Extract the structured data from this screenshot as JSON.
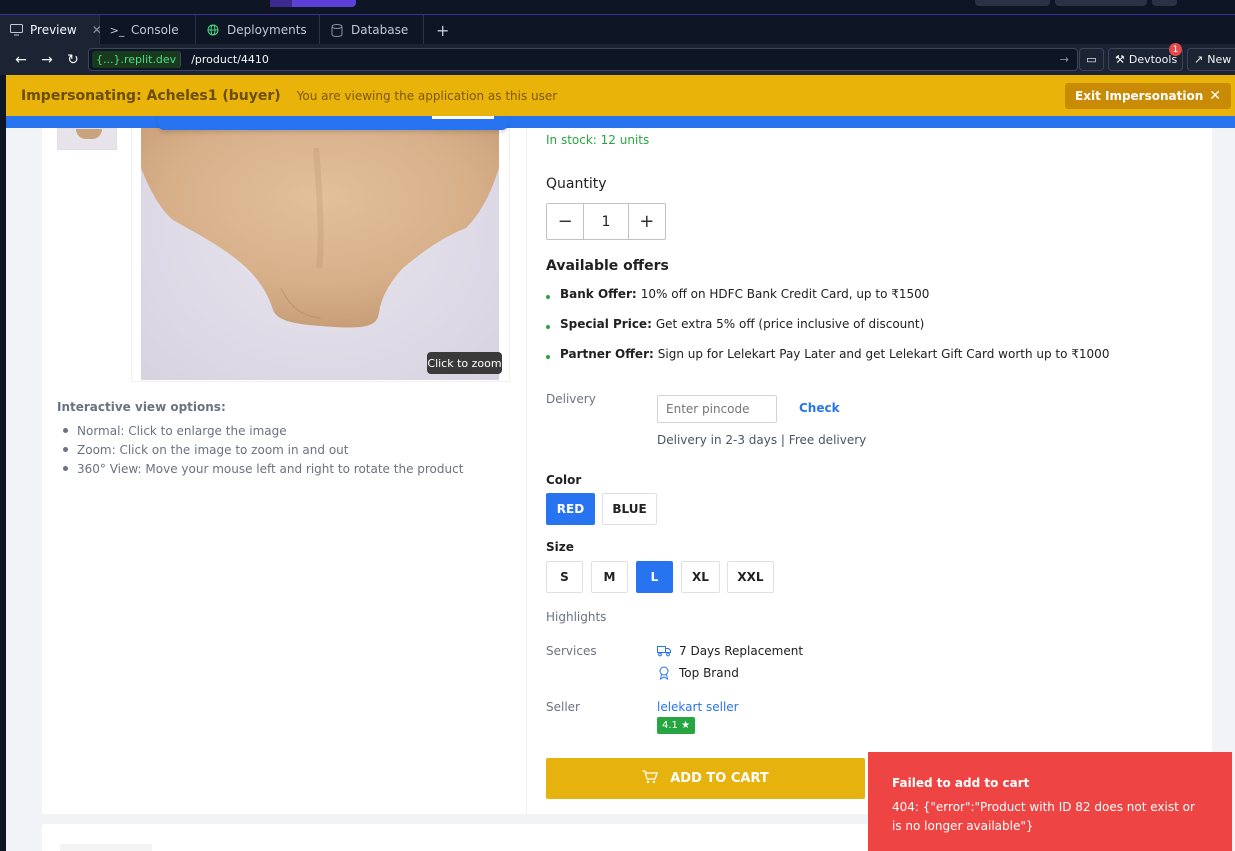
{
  "ide": {
    "tabs": [
      {
        "label": "Preview",
        "icon": "monitor-icon",
        "active": true,
        "closable": true
      },
      {
        "label": "Console",
        "icon": "terminal-icon"
      },
      {
        "label": "Deployments",
        "icon": "globe-icon"
      },
      {
        "label": "Database",
        "icon": "database-icon"
      }
    ],
    "add_tab": "+"
  },
  "urlbar": {
    "domain": "{...}.replit.dev",
    "path": "/product/4410",
    "devtools_label": "Devtools",
    "devtools_badge": "1",
    "new_tab_label": "New"
  },
  "banner": {
    "title": "Impersonating: Acheles1 (buyer)",
    "subtitle": "You are viewing the application as this user",
    "exit_label": "Exit Impersonation",
    "color": "#e9b309"
  },
  "product": {
    "zoom_tooltip": "Click to zoom",
    "interactive_title": "Interactive view options:",
    "interactive_items": [
      "Normal: Click to enlarge the image",
      "Zoom: Click on the image to zoom in and out",
      "360° View: Move your mouse left and right to rotate the product"
    ],
    "stock": "In stock: 12 units",
    "quantity_label": "Quantity",
    "quantity_value": "1",
    "offers_title": "Available offers",
    "offers": [
      {
        "name": "Bank Offer:",
        "text": "10% off on HDFC Bank Credit Card, up to ₹1500"
      },
      {
        "name": "Special Price:",
        "text": "Get extra 5% off (price inclusive of discount)"
      },
      {
        "name": "Partner Offer:",
        "text": "Sign up for Lelekart Pay Later and get Lelekart Gift Card worth up to ₹1000"
      }
    ],
    "delivery_label": "Delivery",
    "pincode_placeholder": "Enter pincode",
    "check_label": "Check",
    "delivery_info": "Delivery in 2-3 days | Free delivery",
    "color_label": "Color",
    "colors": [
      "RED",
      "BLUE"
    ],
    "selected_color": "RED",
    "size_label": "Size",
    "sizes": [
      "S",
      "M",
      "L",
      "XL",
      "XXL"
    ],
    "selected_size": "L",
    "highlights_label": "Highlights",
    "services_label": "Services",
    "services": [
      {
        "icon": "truck-icon",
        "text": "7 Days Replacement"
      },
      {
        "icon": "award-icon",
        "text": "Top Brand"
      }
    ],
    "seller_label": "Seller",
    "seller_name": "lelekart seller",
    "seller_rating": "4.1 ★",
    "add_to_cart": "ADD TO CART",
    "accent": "#2874f0",
    "cart_color": "#e6b30e"
  },
  "toast": {
    "title": "Failed to add to cart",
    "message": "404: {\"error\":\"Product with ID 82 does not exist or is no longer available\"}",
    "color": "#ef4444"
  }
}
